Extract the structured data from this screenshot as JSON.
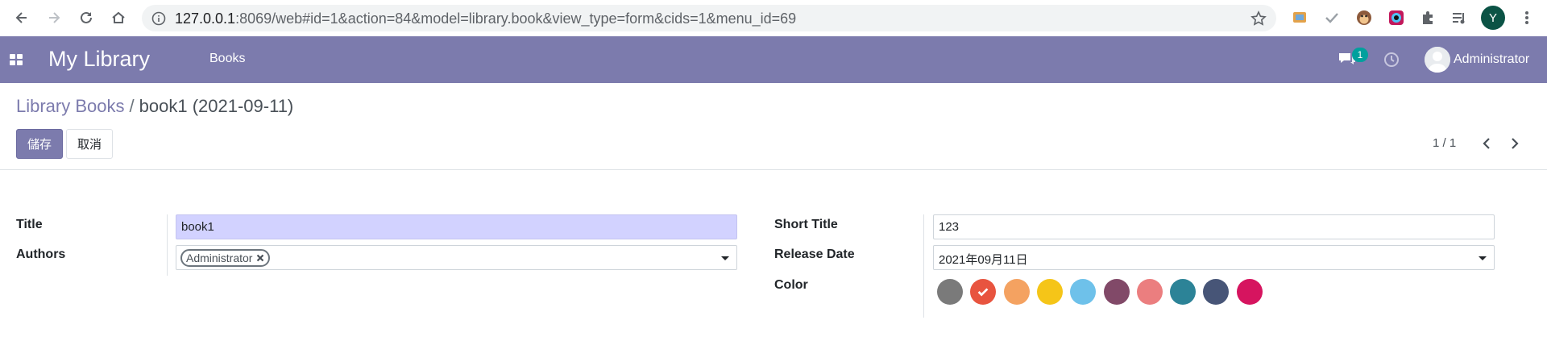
{
  "browser": {
    "url_host": "127.0.0.1",
    "url_rest": ":8069/web#id=1&action=84&model=library.book&view_type=form&cids=1&menu_id=69",
    "profile_initial": "Y"
  },
  "navbar": {
    "brand": "My Library",
    "menu_books": "Books",
    "chat_count": "1",
    "user_name": "Administrator"
  },
  "control_panel": {
    "breadcrumb_parent": "Library Books",
    "breadcrumb_separator": "/",
    "breadcrumb_current": "book1 (2021-09-11)",
    "save_label": "儲存",
    "discard_label": "取消",
    "pager": "1 / 1"
  },
  "form": {
    "title_label": "Title",
    "title_value": "book1",
    "authors_label": "Authors",
    "author_tag": "Administrator",
    "short_title_label": "Short Title",
    "short_title_value": "123",
    "release_date_label": "Release Date",
    "release_date_value": "2021年09月11日",
    "color_label": "Color",
    "colors": [
      "#7a7a7a",
      "#e8543f",
      "#f4a261",
      "#f5c518",
      "#6ec1ea",
      "#814968",
      "#eb7e7f",
      "#2c8397",
      "#475577",
      "#d6145f"
    ],
    "selected_color_index": 1
  }
}
